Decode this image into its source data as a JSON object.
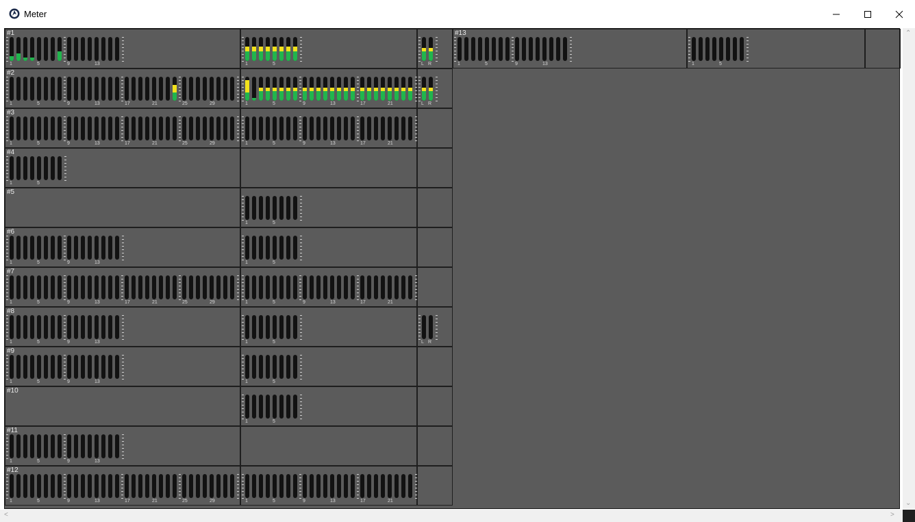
{
  "window": {
    "title": "Meter",
    "controls": {
      "minimize": "minimize-icon",
      "maximize": "maximize-icon",
      "close": "close-icon"
    }
  },
  "meter_rows": [
    {
      "label": "#1",
      "cells": [
        {
          "count": 16,
          "labels": [
            "1",
            "5",
            "9",
            "13"
          ],
          "green": [
            0.2,
            0.3,
            0.15,
            0.15,
            0,
            0,
            0,
            0.4,
            0,
            0,
            0,
            0,
            0,
            0,
            0,
            0
          ],
          "yellow": [
            0,
            0,
            0,
            0,
            0,
            0,
            0,
            0,
            0,
            0,
            0,
            0,
            0,
            0,
            0,
            0
          ]
        },
        {
          "count": 8,
          "labels": [
            "1",
            "5"
          ],
          "green": [
            0.4,
            0.4,
            0.4,
            0.4,
            0.4,
            0.4,
            0.4,
            0.4
          ],
          "yellow": [
            0.2,
            0.2,
            0.2,
            0.2,
            0.2,
            0.2,
            0.2,
            0.2
          ]
        },
        {
          "count": 2,
          "labels": [
            "L",
            "R"
          ],
          "green": [
            0.4,
            0.4
          ],
          "yellow": [
            0.15,
            0.15
          ]
        }
      ]
    },
    {
      "label": "#2",
      "cells": [
        {
          "count": 32,
          "labels": [
            "1",
            "5",
            "9",
            "13",
            "17",
            "21",
            "25",
            "29"
          ],
          "green": [
            0,
            0,
            0,
            0,
            0,
            0,
            0,
            0,
            0,
            0,
            0,
            0,
            0,
            0,
            0,
            0,
            0,
            0,
            0,
            0,
            0,
            0,
            0,
            0.35,
            0,
            0,
            0,
            0,
            0,
            0,
            0,
            0
          ],
          "yellow": [
            0,
            0,
            0,
            0,
            0,
            0,
            0,
            0,
            0,
            0,
            0,
            0,
            0,
            0,
            0,
            0,
            0,
            0,
            0,
            0,
            0,
            0,
            0,
            0.3,
            0,
            0,
            0,
            0,
            0,
            0,
            0,
            0
          ]
        },
        {
          "count": 24,
          "labels": [
            "1",
            "5",
            "9",
            "13",
            "17",
            "21"
          ],
          "green": [
            0.35,
            0.1,
            0.4,
            0.4,
            0.4,
            0.4,
            0.4,
            0.4,
            0.4,
            0.4,
            0.4,
            0.4,
            0.4,
            0.4,
            0.4,
            0.4,
            0.4,
            0.4,
            0.4,
            0.4,
            0.4,
            0.4,
            0.4,
            0.4
          ],
          "yellow": [
            0.5,
            0,
            0.15,
            0.15,
            0.15,
            0.15,
            0.15,
            0.15,
            0.15,
            0.15,
            0.15,
            0.15,
            0.15,
            0.15,
            0.15,
            0.15,
            0.15,
            0.15,
            0.15,
            0.15,
            0.15,
            0.15,
            0.15,
            0.15
          ]
        },
        {
          "count": 2,
          "labels": [
            "L",
            "R"
          ],
          "green": [
            0.4,
            0.4
          ],
          "yellow": [
            0.15,
            0.15
          ]
        }
      ]
    },
    {
      "label": "#3",
      "cells": [
        {
          "count": 32,
          "labels": [
            "1",
            "5",
            "9",
            "13",
            "17",
            "21",
            "25",
            "29"
          ]
        },
        {
          "count": 24,
          "labels": [
            "1",
            "5",
            "9",
            "13",
            "17",
            "21"
          ]
        },
        {
          "count": 0
        }
      ]
    },
    {
      "label": "#4",
      "cells": [
        {
          "count": 8,
          "labels": [
            "1",
            "5"
          ]
        },
        {
          "count": 0
        },
        {
          "count": 0
        }
      ]
    },
    {
      "label": "#5",
      "cells": [
        {
          "count": 0
        },
        {
          "count": 8,
          "labels": [
            "1",
            "5"
          ]
        },
        {
          "count": 0
        }
      ]
    },
    {
      "label": "#6",
      "cells": [
        {
          "count": 16,
          "labels": [
            "1",
            "5",
            "9",
            "13"
          ]
        },
        {
          "count": 8,
          "labels": [
            "1",
            "5"
          ]
        },
        {
          "count": 0
        }
      ]
    },
    {
      "label": "#7",
      "cells": [
        {
          "count": 32,
          "labels": [
            "1",
            "5",
            "9",
            "13",
            "17",
            "21",
            "25",
            "29"
          ]
        },
        {
          "count": 24,
          "labels": [
            "1",
            "5",
            "9",
            "13",
            "17",
            "21"
          ]
        },
        {
          "count": 0
        }
      ]
    },
    {
      "label": "#8",
      "cells": [
        {
          "count": 16,
          "labels": [
            "1",
            "5",
            "9",
            "13"
          ]
        },
        {
          "count": 8,
          "labels": [
            "1",
            "5"
          ]
        },
        {
          "count": 2,
          "labels": [
            "L",
            "R"
          ]
        }
      ]
    },
    {
      "label": "#9",
      "cells": [
        {
          "count": 16,
          "labels": [
            "1",
            "5",
            "9",
            "13"
          ]
        },
        {
          "count": 8,
          "labels": [
            "1",
            "5"
          ]
        },
        {
          "count": 0
        }
      ]
    },
    {
      "label": "#10",
      "cells": [
        {
          "count": 0
        },
        {
          "count": 8,
          "labels": [
            "1",
            "5"
          ]
        },
        {
          "count": 0
        }
      ]
    },
    {
      "label": "#11",
      "cells": [
        {
          "count": 16,
          "labels": [
            "1",
            "5",
            "9",
            "13"
          ]
        },
        {
          "count": 0
        },
        {
          "count": 0
        }
      ]
    },
    {
      "label": "#12",
      "cells": [
        {
          "count": 32,
          "labels": [
            "1",
            "5",
            "9",
            "13",
            "17",
            "21",
            "25",
            "29"
          ]
        },
        {
          "count": 24,
          "labels": [
            "1",
            "5",
            "9",
            "13",
            "17",
            "21"
          ]
        },
        {
          "count": 0
        }
      ]
    }
  ],
  "meter_13": {
    "label": "#13",
    "cells": [
      {
        "count": 16,
        "labels": [
          "1",
          "5",
          "9",
          "13"
        ]
      },
      {
        "count": 8,
        "labels": [
          "1",
          "5"
        ]
      },
      {
        "count": 0
      }
    ]
  },
  "scrollbars": {
    "up": "up-arrow-icon",
    "down": "down-arrow-icon",
    "left": "left-arrow-icon",
    "right": "right-arrow-icon"
  },
  "colors": {
    "background": "#5b5b5b",
    "bar": "#121212",
    "level_green": "#21b54d",
    "level_yellow": "#f2e21b"
  }
}
